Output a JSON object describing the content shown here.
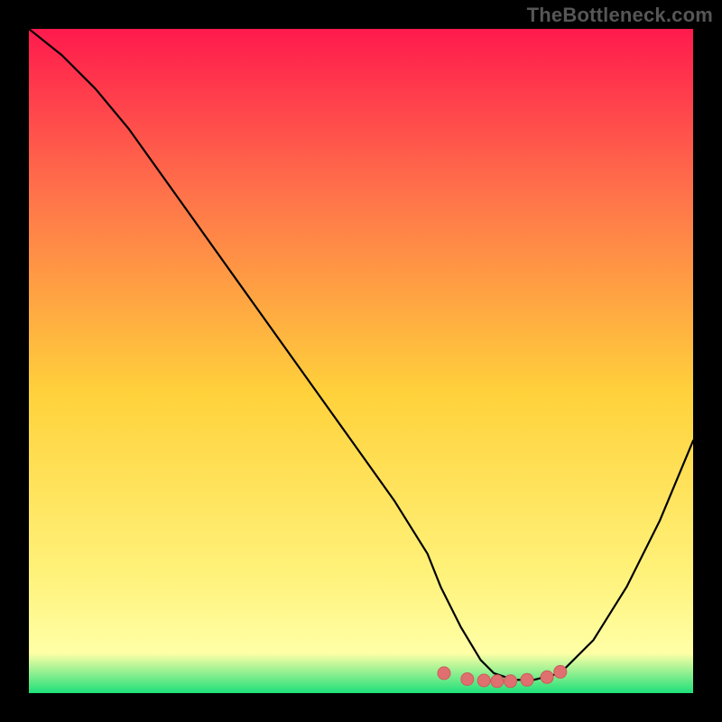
{
  "watermark": "TheBottleneck.com",
  "colors": {
    "frame": "#000000",
    "gradient_top": "#ff1a4d",
    "gradient_upper_mid": "#ff734a",
    "gradient_mid": "#ffd23b",
    "gradient_lower_mid": "#fff27a",
    "gradient_bottom_yellow": "#ffffa6",
    "gradient_bottom_green": "#1ee07a",
    "curve": "#000000",
    "marker_fill": "#e07070",
    "marker_stroke": "#cf5a5a"
  },
  "chart_data": {
    "type": "line",
    "title": "",
    "xlabel": "",
    "ylabel": "",
    "xlim": [
      0,
      100
    ],
    "ylim": [
      0,
      100
    ],
    "series": [
      {
        "name": "bottleneck-curve",
        "x": [
          0,
          5,
          10,
          15,
          20,
          25,
          30,
          35,
          40,
          45,
          50,
          55,
          60,
          62,
          65,
          68,
          70,
          73,
          76,
          80,
          85,
          90,
          95,
          100
        ],
        "y": [
          100,
          96,
          91,
          85,
          78,
          71,
          64,
          57,
          50,
          43,
          36,
          29,
          21,
          16,
          10,
          5,
          3,
          2,
          2,
          3,
          8,
          16,
          26,
          38
        ]
      }
    ],
    "markers": {
      "name": "highlight-cluster",
      "points": [
        {
          "x": 62.5,
          "y": 3.0
        },
        {
          "x": 66.0,
          "y": 2.1
        },
        {
          "x": 68.5,
          "y": 1.9
        },
        {
          "x": 70.5,
          "y": 1.8
        },
        {
          "x": 72.5,
          "y": 1.8
        },
        {
          "x": 75.0,
          "y": 2.0
        },
        {
          "x": 78.0,
          "y": 2.4
        },
        {
          "x": 80.0,
          "y": 3.2
        }
      ]
    }
  }
}
